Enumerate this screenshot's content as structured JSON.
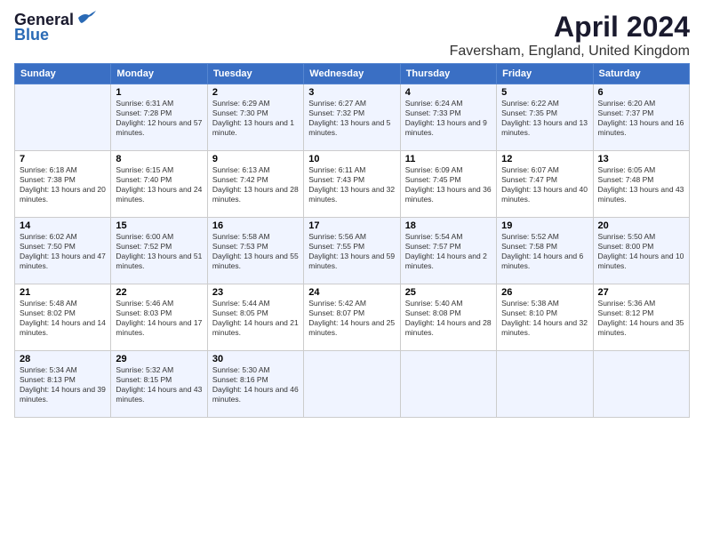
{
  "header": {
    "logo_general": "General",
    "logo_blue": "Blue",
    "month_title": "April 2024",
    "subtitle": "Faversham, England, United Kingdom"
  },
  "weekdays": [
    "Sunday",
    "Monday",
    "Tuesday",
    "Wednesday",
    "Thursday",
    "Friday",
    "Saturday"
  ],
  "weeks": [
    [
      {
        "day": "",
        "sunrise": "",
        "sunset": "",
        "daylight": ""
      },
      {
        "day": "1",
        "sunrise": "Sunrise: 6:31 AM",
        "sunset": "Sunset: 7:28 PM",
        "daylight": "Daylight: 12 hours and 57 minutes."
      },
      {
        "day": "2",
        "sunrise": "Sunrise: 6:29 AM",
        "sunset": "Sunset: 7:30 PM",
        "daylight": "Daylight: 13 hours and 1 minute."
      },
      {
        "day": "3",
        "sunrise": "Sunrise: 6:27 AM",
        "sunset": "Sunset: 7:32 PM",
        "daylight": "Daylight: 13 hours and 5 minutes."
      },
      {
        "day": "4",
        "sunrise": "Sunrise: 6:24 AM",
        "sunset": "Sunset: 7:33 PM",
        "daylight": "Daylight: 13 hours and 9 minutes."
      },
      {
        "day": "5",
        "sunrise": "Sunrise: 6:22 AM",
        "sunset": "Sunset: 7:35 PM",
        "daylight": "Daylight: 13 hours and 13 minutes."
      },
      {
        "day": "6",
        "sunrise": "Sunrise: 6:20 AM",
        "sunset": "Sunset: 7:37 PM",
        "daylight": "Daylight: 13 hours and 16 minutes."
      }
    ],
    [
      {
        "day": "7",
        "sunrise": "Sunrise: 6:18 AM",
        "sunset": "Sunset: 7:38 PM",
        "daylight": "Daylight: 13 hours and 20 minutes."
      },
      {
        "day": "8",
        "sunrise": "Sunrise: 6:15 AM",
        "sunset": "Sunset: 7:40 PM",
        "daylight": "Daylight: 13 hours and 24 minutes."
      },
      {
        "day": "9",
        "sunrise": "Sunrise: 6:13 AM",
        "sunset": "Sunset: 7:42 PM",
        "daylight": "Daylight: 13 hours and 28 minutes."
      },
      {
        "day": "10",
        "sunrise": "Sunrise: 6:11 AM",
        "sunset": "Sunset: 7:43 PM",
        "daylight": "Daylight: 13 hours and 32 minutes."
      },
      {
        "day": "11",
        "sunrise": "Sunrise: 6:09 AM",
        "sunset": "Sunset: 7:45 PM",
        "daylight": "Daylight: 13 hours and 36 minutes."
      },
      {
        "day": "12",
        "sunrise": "Sunrise: 6:07 AM",
        "sunset": "Sunset: 7:47 PM",
        "daylight": "Daylight: 13 hours and 40 minutes."
      },
      {
        "day": "13",
        "sunrise": "Sunrise: 6:05 AM",
        "sunset": "Sunset: 7:48 PM",
        "daylight": "Daylight: 13 hours and 43 minutes."
      }
    ],
    [
      {
        "day": "14",
        "sunrise": "Sunrise: 6:02 AM",
        "sunset": "Sunset: 7:50 PM",
        "daylight": "Daylight: 13 hours and 47 minutes."
      },
      {
        "day": "15",
        "sunrise": "Sunrise: 6:00 AM",
        "sunset": "Sunset: 7:52 PM",
        "daylight": "Daylight: 13 hours and 51 minutes."
      },
      {
        "day": "16",
        "sunrise": "Sunrise: 5:58 AM",
        "sunset": "Sunset: 7:53 PM",
        "daylight": "Daylight: 13 hours and 55 minutes."
      },
      {
        "day": "17",
        "sunrise": "Sunrise: 5:56 AM",
        "sunset": "Sunset: 7:55 PM",
        "daylight": "Daylight: 13 hours and 59 minutes."
      },
      {
        "day": "18",
        "sunrise": "Sunrise: 5:54 AM",
        "sunset": "Sunset: 7:57 PM",
        "daylight": "Daylight: 14 hours and 2 minutes."
      },
      {
        "day": "19",
        "sunrise": "Sunrise: 5:52 AM",
        "sunset": "Sunset: 7:58 PM",
        "daylight": "Daylight: 14 hours and 6 minutes."
      },
      {
        "day": "20",
        "sunrise": "Sunrise: 5:50 AM",
        "sunset": "Sunset: 8:00 PM",
        "daylight": "Daylight: 14 hours and 10 minutes."
      }
    ],
    [
      {
        "day": "21",
        "sunrise": "Sunrise: 5:48 AM",
        "sunset": "Sunset: 8:02 PM",
        "daylight": "Daylight: 14 hours and 14 minutes."
      },
      {
        "day": "22",
        "sunrise": "Sunrise: 5:46 AM",
        "sunset": "Sunset: 8:03 PM",
        "daylight": "Daylight: 14 hours and 17 minutes."
      },
      {
        "day": "23",
        "sunrise": "Sunrise: 5:44 AM",
        "sunset": "Sunset: 8:05 PM",
        "daylight": "Daylight: 14 hours and 21 minutes."
      },
      {
        "day": "24",
        "sunrise": "Sunrise: 5:42 AM",
        "sunset": "Sunset: 8:07 PM",
        "daylight": "Daylight: 14 hours and 25 minutes."
      },
      {
        "day": "25",
        "sunrise": "Sunrise: 5:40 AM",
        "sunset": "Sunset: 8:08 PM",
        "daylight": "Daylight: 14 hours and 28 minutes."
      },
      {
        "day": "26",
        "sunrise": "Sunrise: 5:38 AM",
        "sunset": "Sunset: 8:10 PM",
        "daylight": "Daylight: 14 hours and 32 minutes."
      },
      {
        "day": "27",
        "sunrise": "Sunrise: 5:36 AM",
        "sunset": "Sunset: 8:12 PM",
        "daylight": "Daylight: 14 hours and 35 minutes."
      }
    ],
    [
      {
        "day": "28",
        "sunrise": "Sunrise: 5:34 AM",
        "sunset": "Sunset: 8:13 PM",
        "daylight": "Daylight: 14 hours and 39 minutes."
      },
      {
        "day": "29",
        "sunrise": "Sunrise: 5:32 AM",
        "sunset": "Sunset: 8:15 PM",
        "daylight": "Daylight: 14 hours and 43 minutes."
      },
      {
        "day": "30",
        "sunrise": "Sunrise: 5:30 AM",
        "sunset": "Sunset: 8:16 PM",
        "daylight": "Daylight: 14 hours and 46 minutes."
      },
      {
        "day": "",
        "sunrise": "",
        "sunset": "",
        "daylight": ""
      },
      {
        "day": "",
        "sunrise": "",
        "sunset": "",
        "daylight": ""
      },
      {
        "day": "",
        "sunrise": "",
        "sunset": "",
        "daylight": ""
      },
      {
        "day": "",
        "sunrise": "",
        "sunset": "",
        "daylight": ""
      }
    ]
  ]
}
